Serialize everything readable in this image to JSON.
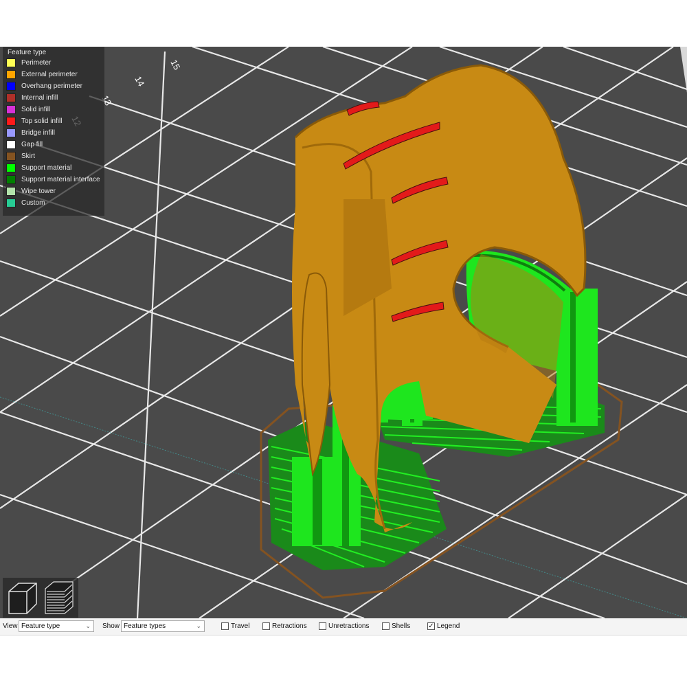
{
  "legend": {
    "title": "Feature type",
    "items": [
      {
        "label": "Perimeter",
        "color": "#ffff55"
      },
      {
        "label": "External perimeter",
        "color": "#ffa500"
      },
      {
        "label": "Overhang perimeter",
        "color": "#0000ff"
      },
      {
        "label": "Internal infill",
        "color": "#b03029"
      },
      {
        "label": "Solid infill",
        "color": "#d732d7"
      },
      {
        "label": "Top solid infill",
        "color": "#ff1a1a"
      },
      {
        "label": "Bridge infill",
        "color": "#9999ff"
      },
      {
        "label": "Gap fill",
        "color": "#ffffff"
      },
      {
        "label": "Skirt",
        "color": "#845321"
      },
      {
        "label": "Support material",
        "color": "#00ff00"
      },
      {
        "label": "Support material interface",
        "color": "#008000"
      },
      {
        "label": "Wipe tower",
        "color": "#b3e3ab"
      },
      {
        "label": "Custom",
        "color": "#28cc94"
      }
    ]
  },
  "bed_labels": [
    "15",
    "14",
    "13",
    "12"
  ],
  "toolbar": {
    "view_label": "View",
    "view_value": "Feature type",
    "show_label": "Show",
    "show_value": "Feature types",
    "travel_label": "Travel",
    "travel_checked": false,
    "retractions_label": "Retractions",
    "retractions_checked": false,
    "unretractions_label": "Unretractions",
    "unretractions_checked": false,
    "shells_label": "Shells",
    "shells_checked": false,
    "legend_label": "Legend",
    "legend_checked": true
  },
  "colors": {
    "bed": "#4a4a4a",
    "grid": "#e6e6e6",
    "model_orange": "#c88a14",
    "support_green": "#1ee61e",
    "skirt": "#845321"
  }
}
